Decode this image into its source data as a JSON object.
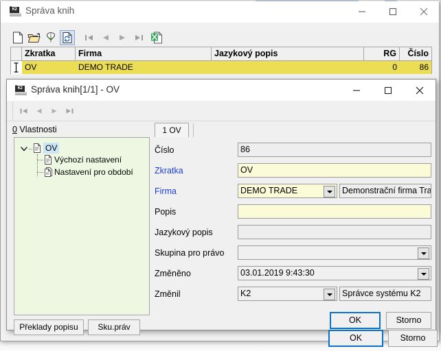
{
  "main_window": {
    "title": "Správa knih",
    "icon": "k2-app-icon",
    "controls": {
      "minimize": "minimize-icon",
      "maximize": "maximize-icon",
      "close": "close-icon"
    },
    "toolbar": [
      {
        "name": "new-record-button",
        "icon": "new-document-icon",
        "state": "normal"
      },
      {
        "name": "open-record-button",
        "icon": "open-folder-icon",
        "state": "normal"
      },
      {
        "name": "filter-button",
        "icon": "filter-icon",
        "state": "normal"
      },
      {
        "name": "refresh-button",
        "icon": "refresh-document-icon",
        "state": "pressed"
      },
      {
        "name": "first-record-button",
        "icon": "first-record-icon",
        "state": "normal"
      },
      {
        "name": "previous-record-button",
        "icon": "previous-record-icon",
        "state": "normal"
      },
      {
        "name": "next-record-button",
        "icon": "next-record-icon",
        "state": "normal"
      },
      {
        "name": "last-record-button",
        "icon": "last-record-icon",
        "state": "normal"
      },
      {
        "name": "export-excel-button",
        "icon": "excel-export-icon",
        "state": "normal"
      }
    ],
    "grid": {
      "columns": [
        "Zkratka",
        "Firma",
        "Jazykový popis",
        "RG",
        "Číslo"
      ],
      "rows": [
        {
          "cells": [
            "OV",
            "DEMO TRADE",
            "",
            "0",
            "86"
          ],
          "selected": true
        }
      ],
      "row_indicator": "text-cursor-icon",
      "selected_row_color": "#ecdd56"
    },
    "bottom_buttons": {
      "ok": "OK",
      "cancel": "Storno"
    }
  },
  "child_dialog": {
    "title": "Správa knih[1/1] - OV",
    "icon": "k2-app-icon",
    "controls": {
      "minimize": "minimize-icon",
      "maximize": "maximize-icon",
      "close": "close-icon"
    },
    "nav_toolbar": [
      {
        "name": "first-record-button",
        "icon": "first-record-icon"
      },
      {
        "name": "previous-record-button",
        "icon": "previous-record-icon"
      },
      {
        "name": "next-record-button",
        "icon": "next-record-icon"
      },
      {
        "name": "last-record-button",
        "icon": "last-record-icon"
      }
    ],
    "properties": {
      "label_accesskey": "0",
      "label_rest": " Vlastnosti",
      "tree": [
        {
          "label": "OV",
          "icon": "document-icon",
          "level": 0,
          "expanded": true,
          "selected": true
        },
        {
          "label": "Výchozí nastavení",
          "icon": "document-icon",
          "level": 1,
          "selected": false
        },
        {
          "label": "Nastavení pro období",
          "icon": "documents-icon",
          "level": 1,
          "selected": false
        }
      ],
      "buttons": [
        {
          "name": "description-translations-button",
          "label": "Překlady popisu"
        },
        {
          "name": "rights-group-button",
          "label": "Sku.práv"
        }
      ]
    },
    "tabs": [
      {
        "label": "1 OV",
        "active": true
      }
    ],
    "form": {
      "fields": [
        {
          "name": "cislo",
          "label": "Číslo",
          "required": false,
          "value": "86",
          "type": "text",
          "readonly": true
        },
        {
          "name": "zkratka",
          "label": "Zkratka",
          "required": true,
          "value": "OV",
          "type": "text",
          "readonly": false
        },
        {
          "name": "firma",
          "label": "Firma",
          "required": true,
          "value": "DEMO TRADE",
          "type": "combo",
          "readonly": false,
          "secondary_value": "Demonstrační firma Trade,"
        },
        {
          "name": "popis",
          "label": "Popis",
          "required": false,
          "value": "",
          "type": "text",
          "readonly": false
        },
        {
          "name": "jazykovy-popis",
          "label": "Jazykový popis",
          "required": false,
          "value": "",
          "type": "text",
          "readonly": true
        },
        {
          "name": "skupina-pro-pravo",
          "label": "Skupina pro právo",
          "required": false,
          "value": "",
          "type": "combo-grey",
          "readonly": true
        },
        {
          "name": "zmeneno",
          "label": "Změněno",
          "required": false,
          "value": "03.01.2019  9:43:30",
          "type": "combo-grey",
          "readonly": true
        },
        {
          "name": "zmenil",
          "label": "Změnil",
          "required": false,
          "value": "K2",
          "type": "combo-grey",
          "readonly": true,
          "secondary_value": "Správce systému K2"
        }
      ]
    },
    "buttons": {
      "ok": "OK",
      "cancel": "Storno"
    }
  },
  "colors": {
    "accent_blue": "#0a71c8",
    "required_label": "#1a3fd0",
    "grid_selection": "#ecdd56",
    "tree_background": "#eef7e2",
    "edit_background": "#fbfbd8"
  }
}
